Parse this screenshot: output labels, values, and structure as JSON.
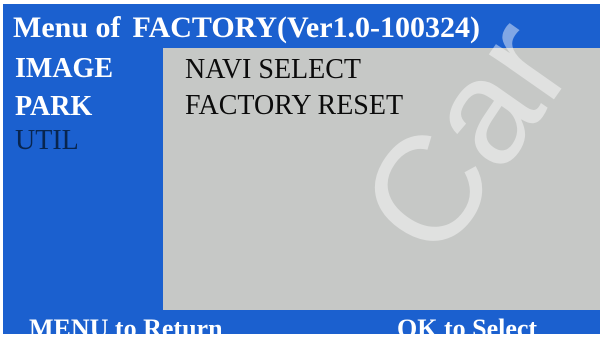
{
  "header": {
    "menu_label": "Menu of",
    "title": "FACTORY(Ver1.0-100324)"
  },
  "sidebar": {
    "items": [
      {
        "label": "IMAGE",
        "state": "normal"
      },
      {
        "label": "PARK",
        "state": "normal"
      },
      {
        "label": "UTIL",
        "state": "selected"
      }
    ]
  },
  "main": {
    "items": [
      {
        "label": "NAVI SELECT"
      },
      {
        "label": "FACTORY RESET"
      }
    ]
  },
  "footer": {
    "left_hint": "MENU to Return",
    "right_hint": "OK to Select"
  },
  "watermark": {
    "text": "Car"
  },
  "colors": {
    "panel": "#1b60cf",
    "content_bg": "#c6c8c6",
    "text_light": "#ffffff",
    "text_dark": "#0b0b0b",
    "selected_text": "#08254f"
  }
}
